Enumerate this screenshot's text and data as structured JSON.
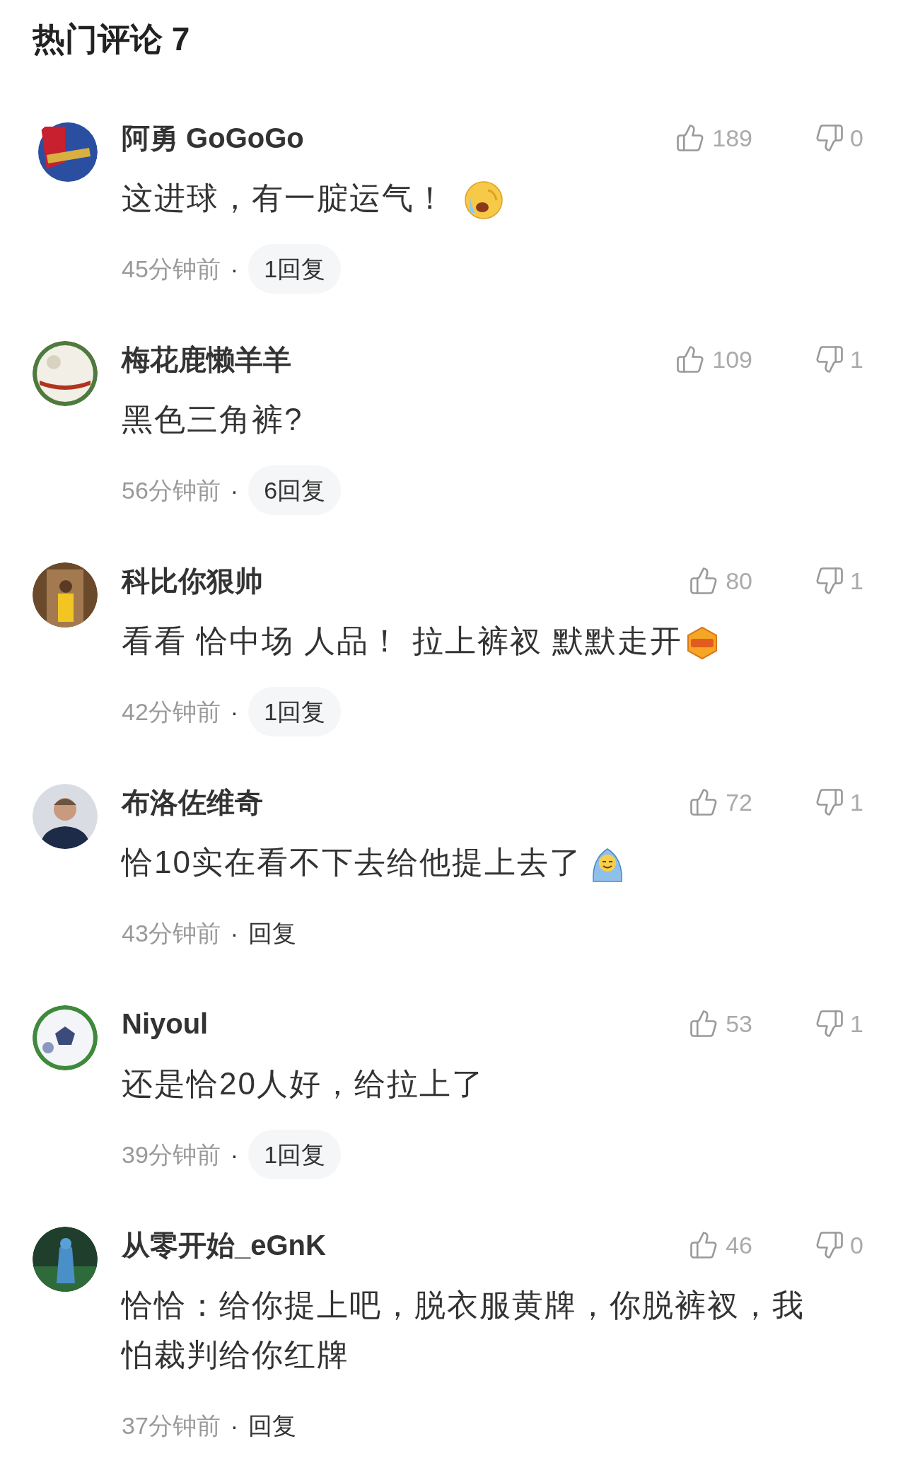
{
  "title": "热门评论 7",
  "comments": [
    {
      "name": "阿勇 GoGoGo",
      "likes": "189",
      "dislikes": "0",
      "text": "这进球，有一腚运气！",
      "emoji": {
        "kind": "cry"
      },
      "time": "45分钟前",
      "separator": "·",
      "reply": {
        "kind": "pill",
        "label": "1回复"
      }
    },
    {
      "name": "梅花鹿懒羊羊",
      "likes": "109",
      "dislikes": "1",
      "text": "黑色三角裤?",
      "time": "56分钟前",
      "separator": "·",
      "reply": {
        "kind": "pill",
        "label": "6回复"
      }
    },
    {
      "name": "科比你狠帅",
      "likes": "80",
      "dislikes": "1",
      "text": "看看 恰中场 人品！ 拉上裤衩 默默走开",
      "emoji": {
        "kind": "mvp"
      },
      "time": "42分钟前",
      "separator": "·",
      "reply": {
        "kind": "pill",
        "label": "1回复"
      }
    },
    {
      "name": "布洛佐维奇",
      "likes": "72",
      "dislikes": "1",
      "text": "恰10实在看不下去给他提上去了",
      "emoji": {
        "kind": "blush"
      },
      "time": "43分钟前",
      "separator": "·",
      "reply": {
        "kind": "plain",
        "label": "回复"
      }
    },
    {
      "name": "Niyoul",
      "likes": "53",
      "dislikes": "1",
      "text": "还是恰20人好，给拉上了",
      "time": "39分钟前",
      "separator": "·",
      "reply": {
        "kind": "pill",
        "label": "1回复"
      }
    },
    {
      "name": "从零开始_eGnK",
      "likes": "46",
      "dislikes": "0",
      "text": "恰恰：给你提上吧，脱衣服黄牌，你脱裤衩，我怕裁判给你红牌",
      "time": "37分钟前",
      "separator": "·",
      "reply": {
        "kind": "plain",
        "label": "回复"
      }
    }
  ]
}
